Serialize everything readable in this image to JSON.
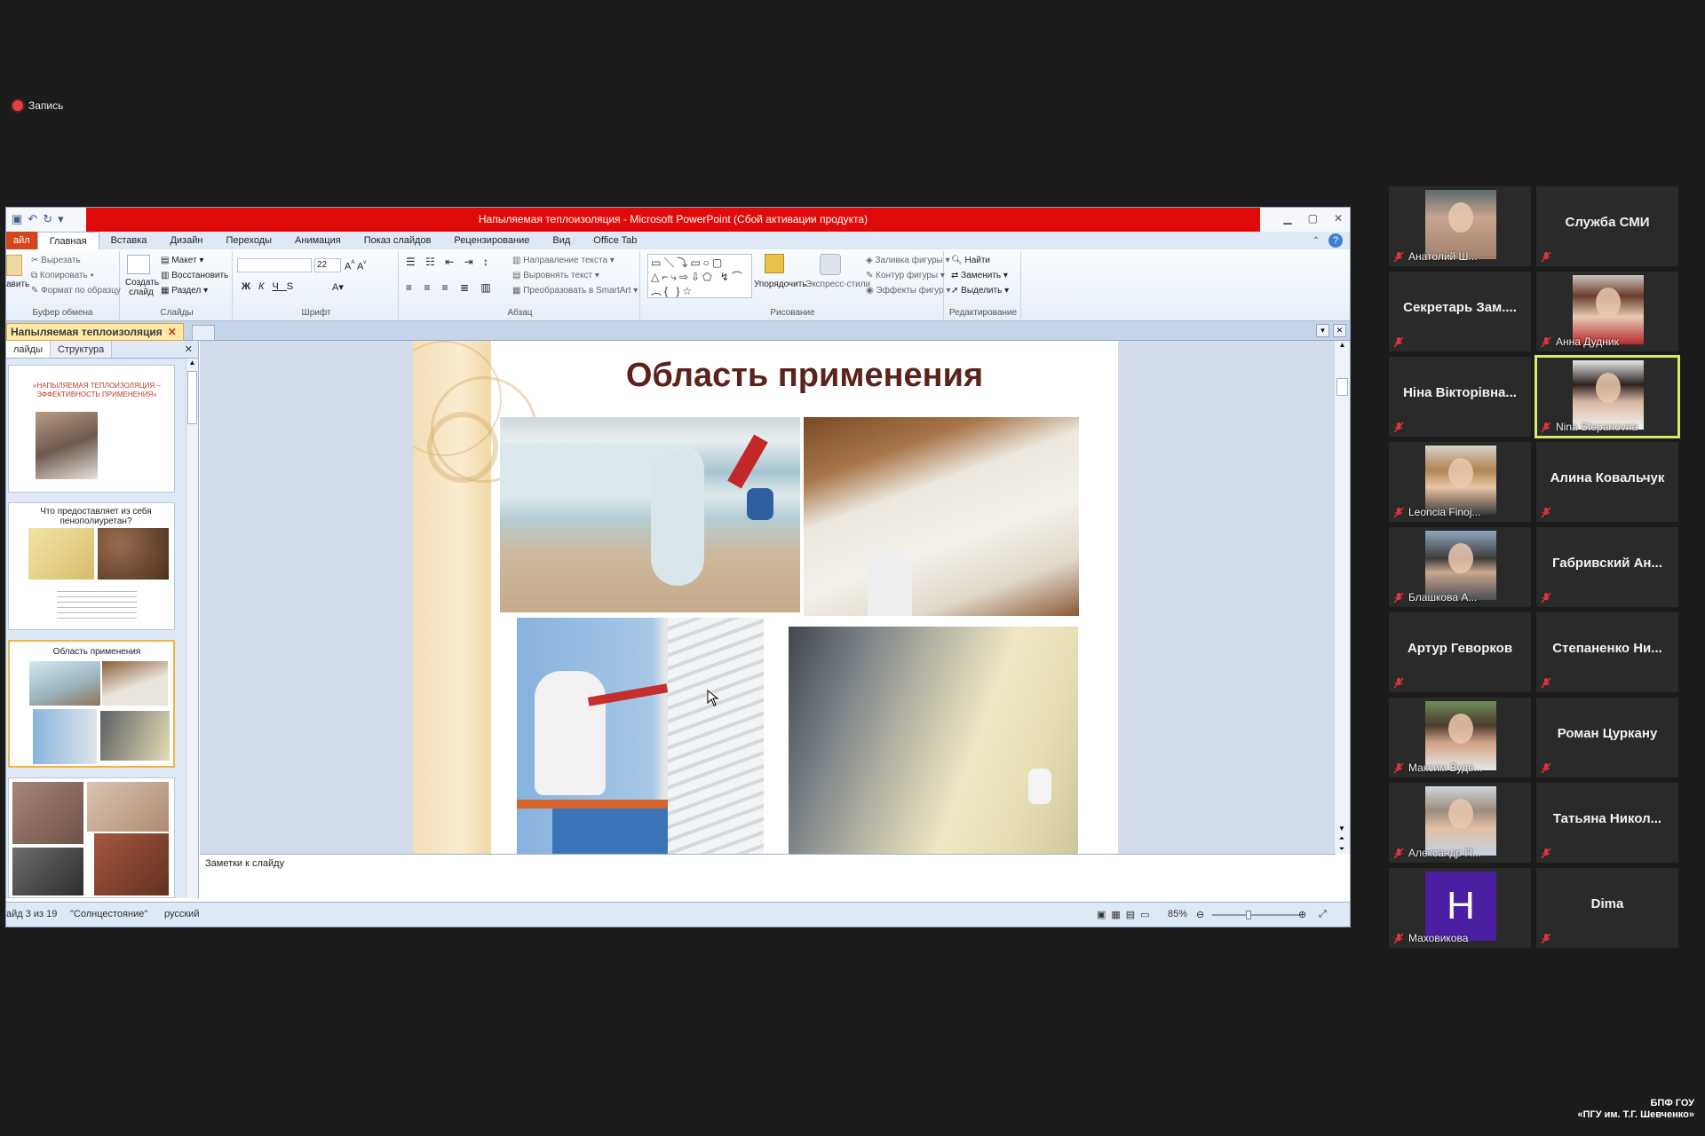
{
  "recording": {
    "label": "Запись"
  },
  "powerpoint": {
    "window_title": "Напыляемая теплоизоляция - Microsoft PowerPoint (Сбой активации продукта)",
    "tabs": [
      {
        "label": "айл"
      },
      {
        "label": "Главная"
      },
      {
        "label": "Вставка"
      },
      {
        "label": "Дизайн"
      },
      {
        "label": "Переходы"
      },
      {
        "label": "Анимация"
      },
      {
        "label": "Показ слайдов"
      },
      {
        "label": "Рецензирование"
      },
      {
        "label": "Вид"
      },
      {
        "label": "Office Tab"
      }
    ],
    "ribbon": {
      "clipboard": {
        "paste": "авить",
        "cut": "Вырезать",
        "copy": "Копировать",
        "format_painter": "Формат по образцу",
        "group": "Буфер обмена"
      },
      "slides": {
        "new_slide": "Создать слайд",
        "layout": "Макет",
        "reset": "Восстановить",
        "section": "Раздел",
        "group": "Слайды"
      },
      "font": {
        "size": "22",
        "group": "Шрифт"
      },
      "paragraph": {
        "text_direction": "Направление текста",
        "align_text": "Выровнять текст",
        "smartart": "Преобразовать в SmartArt",
        "group": "Абзац"
      },
      "drawing": {
        "arrange": "Упорядочить",
        "quick_styles": "Экспресс-стили",
        "fill": "Заливка фигуры",
        "outline": "Контур фигуры",
        "effects": "Эффекты фигур",
        "group": "Рисование"
      },
      "editing": {
        "find": "Найти",
        "replace": "Заменить",
        "select": "Выделить",
        "group": "Редактирование"
      }
    },
    "doc_tab": "Напыляемая теплоизоляция",
    "pane_tabs": [
      "лайды",
      "Структура"
    ],
    "thumbnails": [
      {
        "title": "«НАПЫЛЯЕМАЯ ТЕПЛОИЗОЛЯЦИЯ – ЭФФЕКТИВНОСТЬ ПРИМЕНЕНИЯ»"
      },
      {
        "title": "Что предоставляет из себя пенополиуретан?"
      },
      {
        "title": "Область применения"
      },
      {
        "title": ""
      }
    ],
    "slide_title": "Область применения",
    "notes_placeholder": "Заметки к слайду",
    "status": {
      "slide_info": "айд 3 из 19",
      "theme": "\"Солнцестояние\"",
      "language": "русский",
      "zoom": "85%"
    }
  },
  "participants": [
    {
      "name": "Анатолий Ш...",
      "video": true
    },
    {
      "name": "Служба СМИ",
      "video": false
    },
    {
      "name": "Секретарь Зам....",
      "video": false
    },
    {
      "name": "Анна Дудник",
      "video": true
    },
    {
      "name": "Ніна Вікторівна...",
      "video": false
    },
    {
      "name": "Nina Stepanovna",
      "video": true,
      "speaking": true
    },
    {
      "name": "Leoncia Finoj...",
      "video": true
    },
    {
      "name": "Алина Ковальчук",
      "video": false
    },
    {
      "name": "Блашкова А...",
      "video": true
    },
    {
      "name": "Габривский Ан...",
      "video": false
    },
    {
      "name": "Артур Геворков",
      "video": false
    },
    {
      "name": "Степаненко Ни...",
      "video": false
    },
    {
      "name": "Максим Вудв...",
      "video": true
    },
    {
      "name": "Роман Цуркану",
      "video": false
    },
    {
      "name": "Александр П...",
      "video": true
    },
    {
      "name": "Татьяна Никол...",
      "video": false
    },
    {
      "name": "Маховикова",
      "video": true,
      "initial": "H"
    },
    {
      "name": "Dima",
      "video": false
    }
  ],
  "watermark": {
    "line1": "БПФ ГОУ",
    "line2": "«ПГУ им. Т.Г. Шевченко»"
  },
  "colors": {
    "title_bar_red": "#e00a0a",
    "speaker_highlight": "#d7e86a",
    "slide_title": "#5a231b",
    "mic_muted": "#e0343b",
    "avatar_purple": "#4b1fa1"
  }
}
